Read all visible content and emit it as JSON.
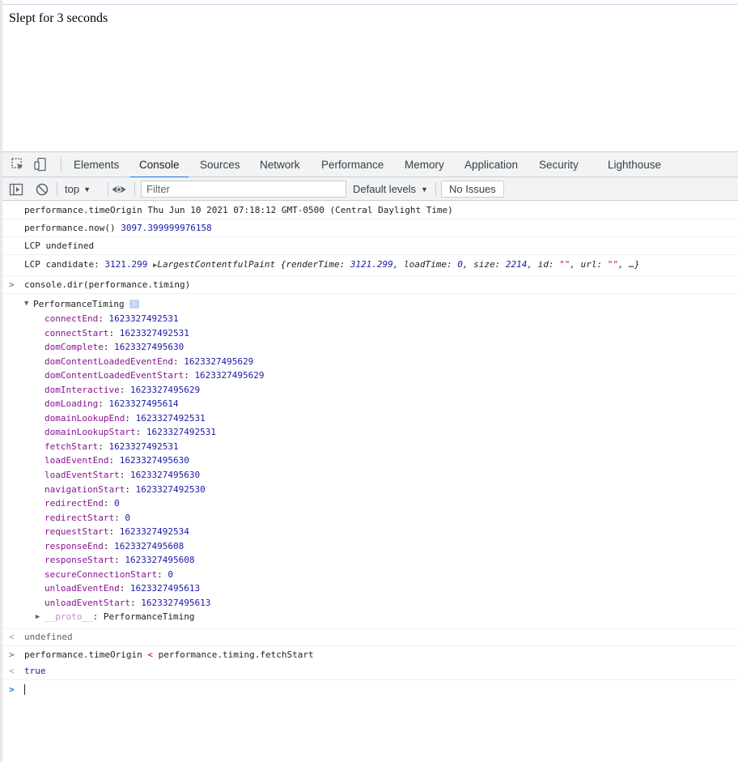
{
  "page": {
    "text": "Slept for 3 seconds"
  },
  "devtools": {
    "tabs": [
      "Elements",
      "Console",
      "Sources",
      "Network",
      "Performance",
      "Memory",
      "Application",
      "Security",
      "Lighthouse"
    ],
    "active_tab": "Console",
    "toolbar": {
      "context": "top",
      "filter_placeholder": "Filter",
      "levels": "Default levels",
      "issues": "No Issues"
    }
  },
  "console": {
    "line1": {
      "text": "performance.timeOrigin Thu Jun 10 2021 07:18:12 GMT-0500 (Central Daylight Time)"
    },
    "line2": {
      "text": "performance.now()",
      "value": "3097.399999976158"
    },
    "line3": {
      "text": "LCP undefined"
    },
    "line4": {
      "label": "LCP candidate:",
      "value": "3121.299",
      "object_name": "LargestContentfulPaint",
      "render_time_key": "renderTime",
      "render_time": "3121.299",
      "load_time_key": "loadTime",
      "load_time": "0",
      "size_key": "size",
      "size": "2214",
      "id_key": "id",
      "id_value": "\"\"",
      "url_key": "url",
      "url_value": "\"\"",
      "ellipsis": "…"
    },
    "command1": "console.dir(performance.timing)",
    "dir": {
      "title": "PerformanceTiming",
      "info_badge": "i",
      "properties": [
        {
          "key": "connectEnd",
          "value": "1623327492531"
        },
        {
          "key": "connectStart",
          "value": "1623327492531"
        },
        {
          "key": "domComplete",
          "value": "1623327495630"
        },
        {
          "key": "domContentLoadedEventEnd",
          "value": "1623327495629"
        },
        {
          "key": "domContentLoadedEventStart",
          "value": "1623327495629"
        },
        {
          "key": "domInteractive",
          "value": "1623327495629"
        },
        {
          "key": "domLoading",
          "value": "1623327495614"
        },
        {
          "key": "domainLookupEnd",
          "value": "1623327492531"
        },
        {
          "key": "domainLookupStart",
          "value": "1623327492531"
        },
        {
          "key": "fetchStart",
          "value": "1623327492531"
        },
        {
          "key": "loadEventEnd",
          "value": "1623327495630"
        },
        {
          "key": "loadEventStart",
          "value": "1623327495630"
        },
        {
          "key": "navigationStart",
          "value": "1623327492530"
        },
        {
          "key": "redirectEnd",
          "value": "0"
        },
        {
          "key": "redirectStart",
          "value": "0"
        },
        {
          "key": "requestStart",
          "value": "1623327492534"
        },
        {
          "key": "responseEnd",
          "value": "1623327495608"
        },
        {
          "key": "responseStart",
          "value": "1623327495608"
        },
        {
          "key": "secureConnectionStart",
          "value": "0"
        },
        {
          "key": "unloadEventEnd",
          "value": "1623327495613"
        },
        {
          "key": "unloadEventStart",
          "value": "1623327495613"
        }
      ],
      "proto_key": "__proto__",
      "proto_value": "PerformanceTiming"
    },
    "result1": "undefined",
    "command2": {
      "left": "performance.timeOrigin",
      "operator": "<",
      "right": "performance.timing.fetchStart"
    },
    "result2": "true"
  },
  "colors": {
    "accent": "#1a73e8",
    "number": "#1a1aa6",
    "property_key": "#881391",
    "string": "#c41a16"
  },
  "icons": [
    "inspect-element-icon",
    "device-toolbar-icon",
    "sidebar-toggle-icon",
    "clear-console-icon",
    "live-expression-eye-icon",
    "chevron-right-icon",
    "triangle-down-icon",
    "triangle-right-icon"
  ]
}
